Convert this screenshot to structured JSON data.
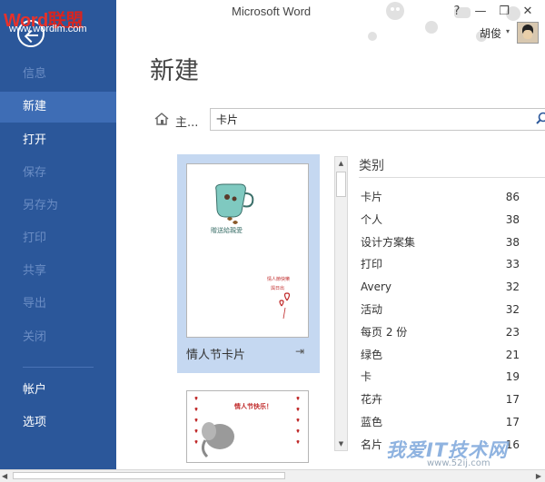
{
  "app": {
    "window_title": "Microsoft Word"
  },
  "watermark": {
    "logo_word": "Word",
    "logo_cn": "联盟",
    "logo_url": "www.wordlm.com",
    "bottom_text": "我爱IT技术网",
    "bottom_url": "www.52ij.com"
  },
  "window_controls": {
    "help": "?",
    "minimize": "—",
    "restore": "❐",
    "close": "✕"
  },
  "user": {
    "name": "胡俊",
    "caret": "▾"
  },
  "sidebar": {
    "items": [
      {
        "label": "信息",
        "state": "disabled"
      },
      {
        "label": "新建",
        "state": "active"
      },
      {
        "label": "打开",
        "state": "enabled"
      },
      {
        "label": "保存",
        "state": "disabled"
      },
      {
        "label": "另存为",
        "state": "disabled"
      },
      {
        "label": "打印",
        "state": "disabled"
      },
      {
        "label": "共享",
        "state": "disabled"
      },
      {
        "label": "导出",
        "state": "disabled"
      },
      {
        "label": "关闭",
        "state": "disabled"
      },
      {
        "label": "帐户",
        "state": "enabled"
      },
      {
        "label": "选项",
        "state": "enabled"
      }
    ]
  },
  "main": {
    "title": "新建",
    "breadcrumb": "主...",
    "search": {
      "value": "卡片"
    },
    "templates": [
      {
        "name": "情人节卡片",
        "pin": "⇥"
      },
      {
        "name": "",
        "pin": ""
      }
    ],
    "thumb1_text": {
      "caption": "贈送給親愛",
      "line1": "情人節快樂",
      "line2": "與日出"
    },
    "thumb2_text": "情人节快乐！"
  },
  "categories": {
    "header": "类别",
    "items": [
      {
        "label": "卡片",
        "count": "86"
      },
      {
        "label": "个人",
        "count": "38"
      },
      {
        "label": "设计方案集",
        "count": "38"
      },
      {
        "label": "打印",
        "count": "33"
      },
      {
        "label": "Avery",
        "count": "32"
      },
      {
        "label": "活动",
        "count": "32"
      },
      {
        "label": "每页 2 份",
        "count": "23"
      },
      {
        "label": "绿色",
        "count": "21"
      },
      {
        "label": "卡",
        "count": "19"
      },
      {
        "label": "花卉",
        "count": "17"
      },
      {
        "label": "蓝色",
        "count": "17"
      },
      {
        "label": "名片",
        "count": "16"
      }
    ]
  },
  "scroll": {
    "up": "▲",
    "down": "▼",
    "left": "◀",
    "right": "▶"
  },
  "colors": {
    "sidebar": "#2b579a",
    "sidebar_active": "#3e6db5",
    "selected_card": "#c5d8f1",
    "watermark_red": "#e8312a"
  }
}
